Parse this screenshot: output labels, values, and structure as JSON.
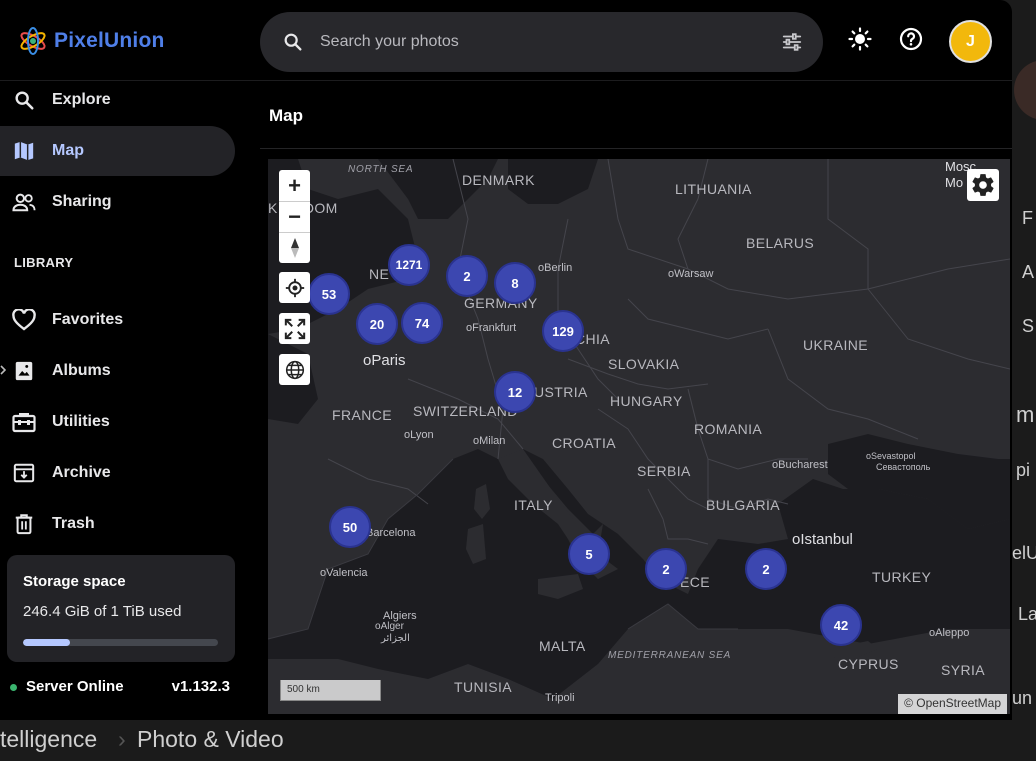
{
  "app": {
    "name": "PixelUnion",
    "brand_color": "#4f7fe8",
    "accent_color": "#b5c8ff"
  },
  "header": {
    "search_placeholder": "Search your photos",
    "avatar_initial": "J",
    "avatar_color": "#f2b80c",
    "icons": [
      "search-icon",
      "tune-icon",
      "theme-sun-icon",
      "help-icon"
    ]
  },
  "sidebar": {
    "items": [
      {
        "label": "Explore",
        "icon": "search-icon",
        "active": false
      },
      {
        "label": "Map",
        "icon": "map-icon",
        "active": true
      },
      {
        "label": "Sharing",
        "icon": "people-icon",
        "active": false
      }
    ],
    "library_heading": "LIBRARY",
    "library_items": [
      {
        "label": "Favorites",
        "icon": "heart-icon"
      },
      {
        "label": "Albums",
        "icon": "albums-icon"
      },
      {
        "label": "Utilities",
        "icon": "toolbox-icon"
      },
      {
        "label": "Archive",
        "icon": "archive-icon"
      },
      {
        "label": "Trash",
        "icon": "trash-icon"
      }
    ],
    "storage": {
      "title": "Storage space",
      "used_text": "246.4 GiB of 1 TiB used",
      "used_fraction": 0.24
    },
    "server": {
      "status": "Server Online",
      "version": "v1.132.3"
    }
  },
  "main": {
    "title": "Map"
  },
  "map": {
    "countries": [
      "DENMARK",
      "LITHUANIA",
      "BELARUS",
      "KINGDOM",
      "NE",
      "GERMANY",
      "UKRAINE",
      "CHIA",
      "SLOVAKIA",
      "FRANCE",
      "SWITZERLAND",
      "USTRIA",
      "HUNGARY",
      "ROMANIA",
      "CROATIA",
      "SERBIA",
      "ITALY",
      "BULGARIA",
      "ECE",
      "TURKEY",
      "MALTA",
      "TUNISIA",
      "CYPRUS",
      "SYRIA"
    ],
    "seas": [
      "NORTH SEA",
      "MEDITERRANEAN SEA"
    ],
    "cities": [
      "Berlin",
      "Warsaw",
      "Paris",
      "Frankfurt",
      "Lyon",
      "Milan",
      "Bucharest",
      "Sevastopol",
      "Севастополь",
      "Barcelona",
      "Valencia",
      "Istanbul",
      "Algiers",
      "Alger",
      "الجزائر",
      "Aleppo",
      "Tripoli",
      "Mosc",
      "Mo"
    ],
    "clusters": [
      {
        "count": "1271"
      },
      {
        "count": "2"
      },
      {
        "count": "8"
      },
      {
        "count": "53"
      },
      {
        "count": "20"
      },
      {
        "count": "74"
      },
      {
        "count": "129"
      },
      {
        "count": "12"
      },
      {
        "count": "50"
      },
      {
        "count": "5"
      },
      {
        "count": "2"
      },
      {
        "count": "2"
      },
      {
        "count": "42"
      }
    ],
    "scale_label": "500 km",
    "attribution": "© OpenStreetMap",
    "zoom_in": "+",
    "zoom_out": "−"
  },
  "background": {
    "bottom_left": "telligence",
    "bottom_right": "Photo & Video",
    "peek_letters": [
      "F",
      "A",
      "S",
      "m",
      "pi",
      "elU",
      "La",
      "un",
      "p"
    ]
  }
}
